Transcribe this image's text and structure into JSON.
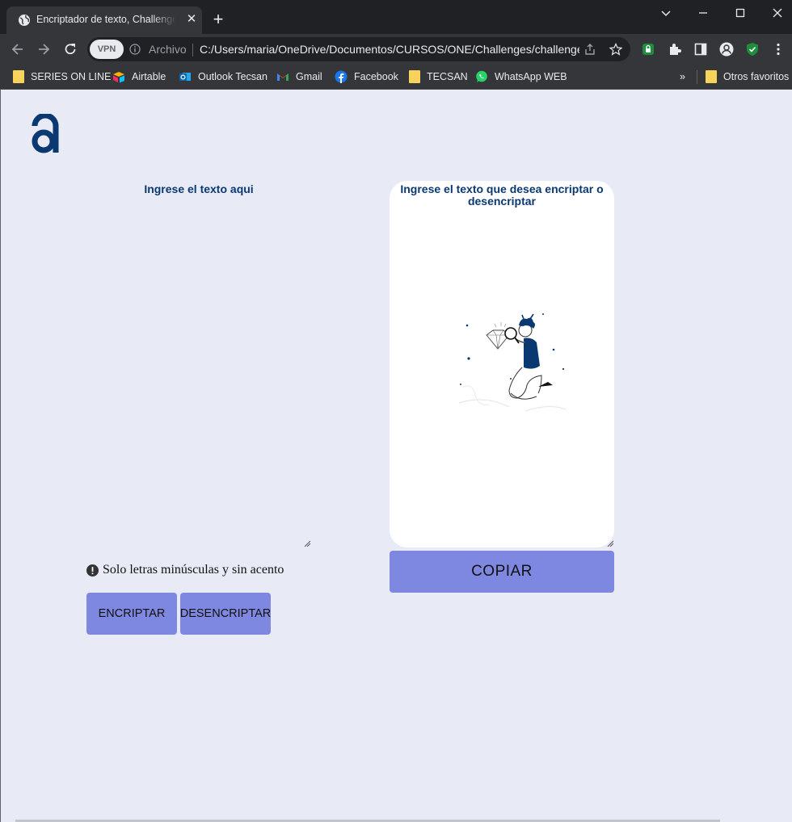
{
  "browser": {
    "tab_title": "Encriptador de texto, Challenge ONE",
    "omnibox": {
      "vpn_label": "VPN",
      "scheme_label": "Archivo",
      "url": "C:/Users/maria/OneDrive/Documentos/CURSOS/ONE/Challenges/challenge-encriptador/index.html"
    },
    "bookmarks": [
      {
        "label": "SERIES ON LINE",
        "icon": "folder-icon"
      },
      {
        "label": "Airtable",
        "icon": "airtable-icon"
      },
      {
        "label": "Outlook Tecsan",
        "icon": "outlook-icon"
      },
      {
        "label": "Gmail",
        "icon": "gmail-icon"
      },
      {
        "label": "Facebook",
        "icon": "facebook-icon"
      },
      {
        "label": "TECSAN",
        "icon": "folder-icon"
      },
      {
        "label": "WhatsApp WEB",
        "icon": "whatsapp-icon"
      }
    ],
    "more_bookmarks": "»",
    "other_bookmarks": "Otros favoritos"
  },
  "page": {
    "input": {
      "placeholder": "Ingrese el texto aqui"
    },
    "warning": "Solo letras minúsculas y sin acento",
    "buttons": {
      "encrypt": "ENCRIPTAR",
      "decrypt": "DESENCRIPTAR",
      "copy": "COPIAR"
    },
    "output": {
      "placeholder": "Ingrese el texto que desea encriptar o desencriptar"
    }
  },
  "colors": {
    "page_bg": "#e8eaf6",
    "brand_dark": "#0a3871",
    "button_bg": "#7e88e0"
  }
}
